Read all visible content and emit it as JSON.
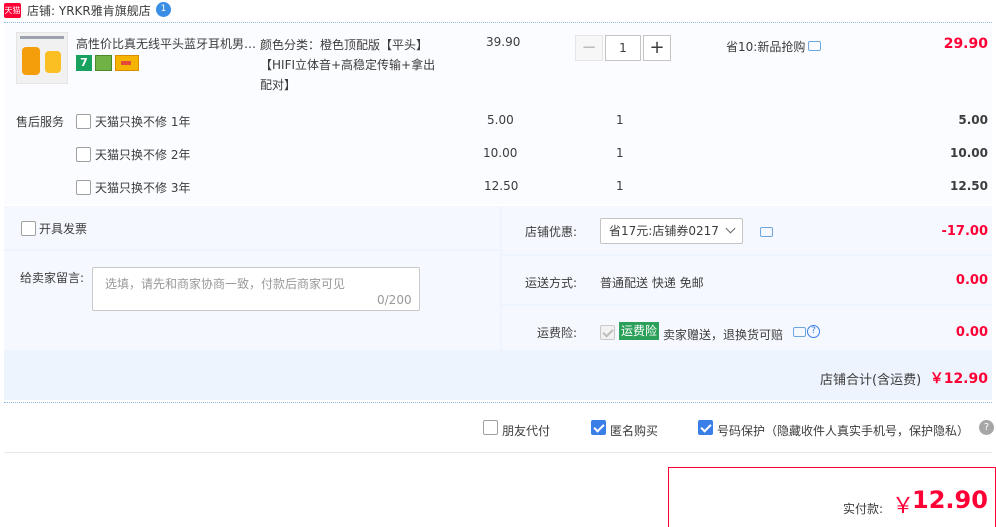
{
  "shop": {
    "badge": "天猫",
    "name": "店铺: YRKR雅肯旗舰店",
    "chat_badge": "1"
  },
  "item": {
    "title": "高性价比真无线平头蓝牙耳机男…",
    "icon_7": "7",
    "sku_lines": [
      "颜色分类：橙色顶配版【平头】",
      "【HIFI立体音+高稳定传输+拿出",
      "配对】"
    ],
    "price": "39.90",
    "quantity": "1",
    "minus": "−",
    "plus": "+",
    "promo": "省10:新品抢购",
    "total": "29.90"
  },
  "after_sales": {
    "label": "售后服务",
    "options": [
      {
        "name": "天猫只换不修 1年",
        "price": "5.00",
        "qty": "1",
        "total": "5.00"
      },
      {
        "name": "天猫只换不修 2年",
        "price": "10.00",
        "qty": "1",
        "total": "10.00"
      },
      {
        "name": "天猫只换不修 3年",
        "price": "12.50",
        "qty": "1",
        "total": "12.50"
      }
    ]
  },
  "invoice": {
    "label": "开具发票"
  },
  "message": {
    "label": "给卖家留言:",
    "placeholder": "选填，请先和商家协商一致，付款后商家可见",
    "count": "0/200"
  },
  "coupon": {
    "label": "店铺优惠:",
    "selected": "省17元:店铺券0217",
    "value": "-17.00"
  },
  "shipping": {
    "label": "运送方式:",
    "method": "普通配送 快递 免邮",
    "value": "0.00"
  },
  "insurance": {
    "label": "运费险:",
    "tag": "运费险",
    "text": "卖家赠送，退换货可赔",
    "value": "0.00"
  },
  "subtotal": {
    "label": "店铺合计(含运费)",
    "value": "￥12.90"
  },
  "options": {
    "friend_pay": "朋友代付",
    "anonymous": "匿名购买",
    "privacy": "号码保护（隐藏收件人真实手机号，保护隐私）",
    "help": "?"
  },
  "payment": {
    "label": "实付款:",
    "yen": "￥",
    "value": "12.90"
  },
  "colors": {
    "accent_red": "#ff0036",
    "accent_blue": "#3a7ee8",
    "insurance_green": "#2ca05a"
  }
}
